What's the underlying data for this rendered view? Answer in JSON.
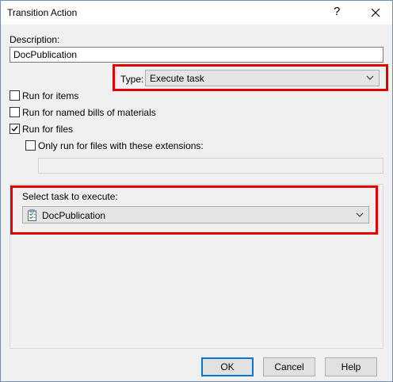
{
  "window": {
    "title": "Transition Action",
    "help_glyph": "?",
    "close_icon": "close-icon"
  },
  "description": {
    "label": "Description:",
    "value": "DocPublication"
  },
  "type": {
    "label": "Type:",
    "value": "Execute task"
  },
  "options": {
    "run_for_items": {
      "label": "Run for items",
      "checked": false
    },
    "run_for_boms": {
      "label": "Run for named bills of materials",
      "checked": false
    },
    "run_for_files": {
      "label": "Run for files",
      "checked": true
    },
    "only_extensions": {
      "label": "Only run for files with these extensions:",
      "checked": false
    },
    "extensions_value": ""
  },
  "task": {
    "label": "Select task to execute:",
    "value": "DocPublication",
    "icon": "task-document-icon"
  },
  "buttons": {
    "ok": "OK",
    "cancel": "Cancel",
    "help": "Help"
  },
  "colors": {
    "highlight": "#e00000",
    "default_button_border": "#0078d7"
  }
}
